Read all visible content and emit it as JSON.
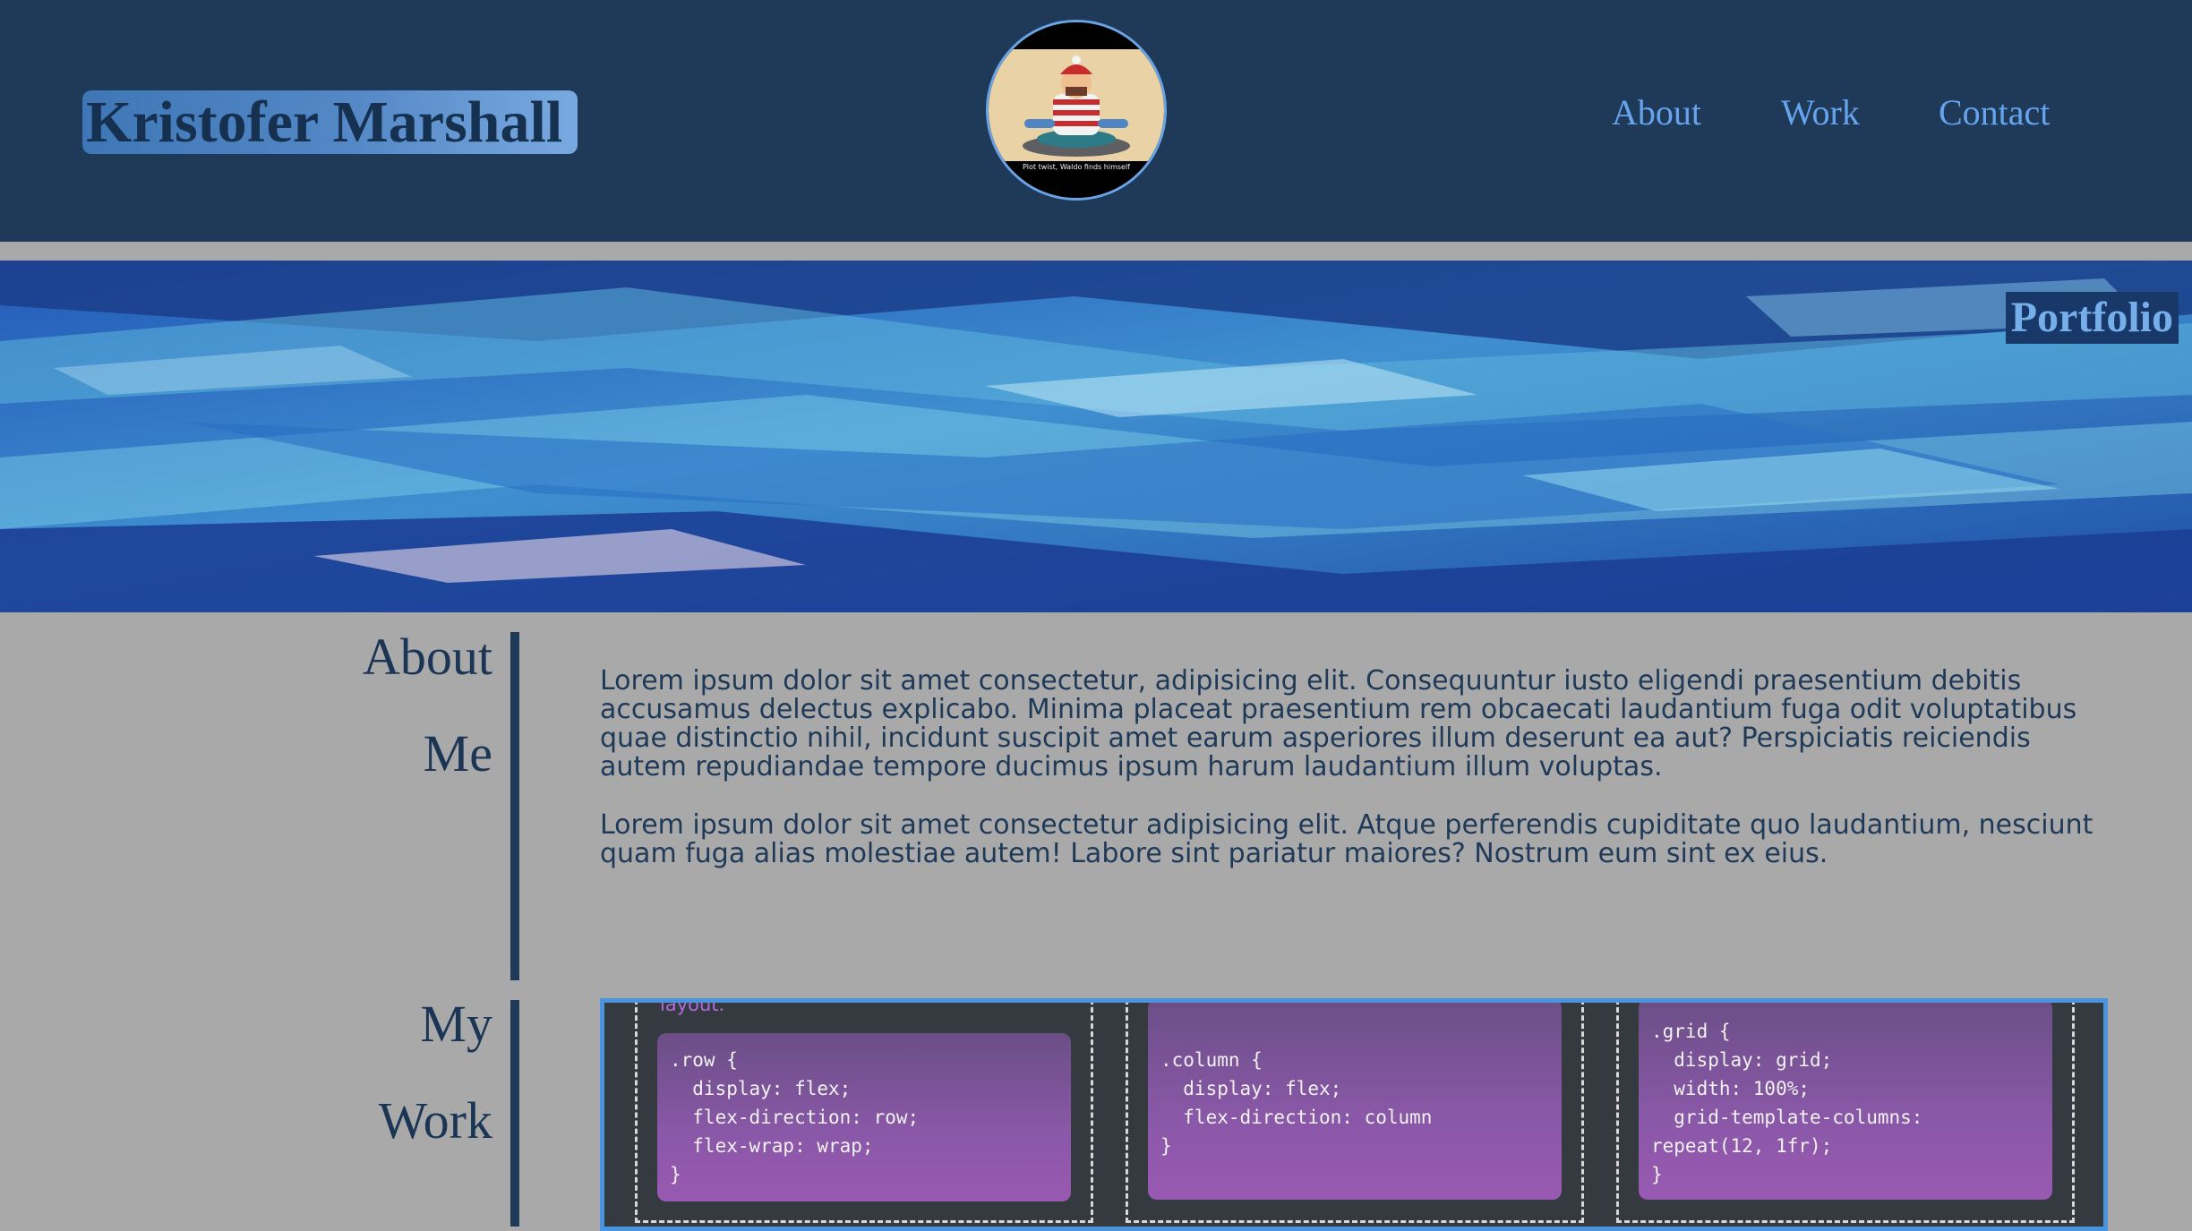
{
  "header": {
    "brand": "Kristofer Marshall",
    "avatar_caption": "Plot twist, Waldo finds himself",
    "nav": [
      {
        "label": "About"
      },
      {
        "label": "Work"
      },
      {
        "label": "Contact"
      }
    ]
  },
  "banner": {
    "label": "Portfolio"
  },
  "about": {
    "title": "About Me",
    "paragraphs": [
      "Lorem ipsum dolor sit amet consectetur, adipisicing elit. Consequuntur iusto eligendi praesentium debitis accusamus delectus explicabo. Minima placeat praesentium rem obcaecati laudantium fuga odit voluptatibus quae distinctio nihil, incidunt suscipit amet earum asperiores illum deserunt ea aut? Perspiciatis reiciendis autem repudiandae tempore ducimus ipsum harum laudantium illum voluptas.",
      "Lorem ipsum dolor sit amet consectetur adipisicing elit. Atque perferendis cupiditate quo laudantium, nesciunt quam fuga alias molestiae autem! Labore sint pariatur maiores? Nostrum eum sint ex eius."
    ]
  },
  "work": {
    "title": "My Work",
    "caption": "layout.",
    "code_samples": [
      ".row {\n  display: flex;\n  flex-direction: row;\n  flex-wrap: wrap;\n}",
      ".column {\n  display: flex;\n  flex-direction: column\n}",
      ".grid {\n  display: grid;\n  width: 100%;\n  grid-template-columns:\nrepeat(12, 1fr);\n}"
    ]
  },
  "colors": {
    "header_bg": "#1e3a58",
    "page_bg": "#a9a9a9",
    "nav_link": "#66a5ee",
    "card_border": "#4a93df",
    "code_box": "#8a58a8"
  }
}
